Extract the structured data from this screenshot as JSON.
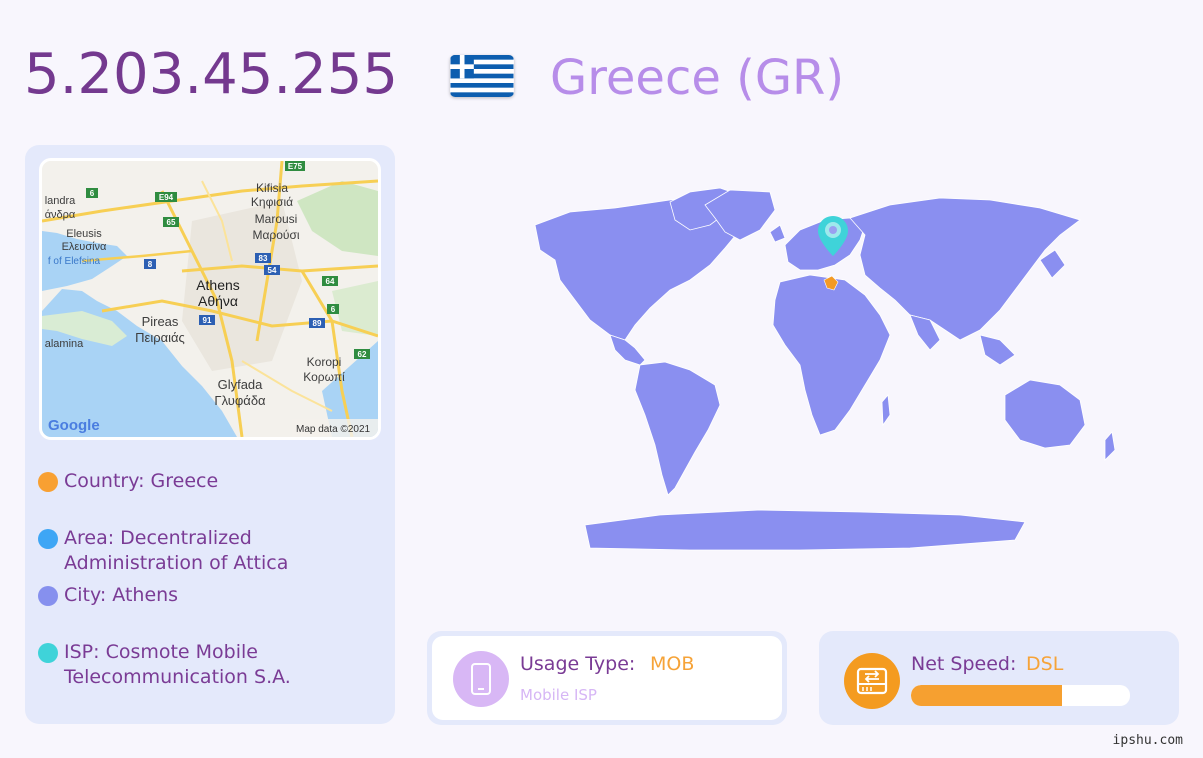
{
  "header": {
    "ip": "5.203.45.255",
    "country_title": "Greece (GR)"
  },
  "mini_map": {
    "labels": {
      "kifisia": "Kifisia",
      "kifisia_gr": "Κηφισιά",
      "marousi": "Marousi",
      "marousi_gr": "Μαρούσι",
      "andra": "landra",
      "andra_gr": "άνδρα",
      "eleusis": "Eleusis",
      "eleusis_gr": "Ελευσίνα",
      "elefsina_gulf": "f of Elefsina",
      "athens": "Athens",
      "athens_gr": "Αθήνα",
      "pireas": "Pireas",
      "pireas_gr": "Πειραιάς",
      "salamina": "alamina",
      "koropi": "Koropi",
      "koropi_gr": "Κορωπί",
      "glyfada": "Glyfada",
      "glyfada_gr": "Γλυφάδα",
      "google": "Google",
      "credit": "Map data ©2021"
    },
    "shields": {
      "e75": "E75",
      "e94": "E94",
      "r6a": "6",
      "r65": "65",
      "r8": "8",
      "r83": "83",
      "r54": "54",
      "r64": "64",
      "r6b": "6",
      "r91": "91",
      "r89": "89",
      "r62": "62"
    }
  },
  "info": {
    "country": "Country: Greece",
    "area": "Area: Decentralized Administration of Attica",
    "city": "City: Athens",
    "isp": "ISP: Cosmote Mobile Telecommunication S.A."
  },
  "usage": {
    "label": "Usage Type:",
    "value": "MOB",
    "sub": "Mobile ISP"
  },
  "speed": {
    "label": "Net Speed:",
    "value": "DSL",
    "fill_percent": 69
  },
  "footer": {
    "site": "ipshu.com"
  },
  "colors": {
    "ip_text": "#74398f",
    "country_text": "#b78de9",
    "panel_bg": "#e4e9fb",
    "dot_country": "#f8a032",
    "dot_area": "#3ea6f5",
    "dot_city": "#8690ee",
    "dot_isp": "#3fd3d9",
    "map_fill": "#8a8ff0",
    "accent_orange": "#f6a338"
  },
  "icons": {
    "flag": "greece-flag-icon",
    "pin": "location-pin-icon",
    "usage": "mobile-phone-icon",
    "speed": "network-drive-icon"
  }
}
